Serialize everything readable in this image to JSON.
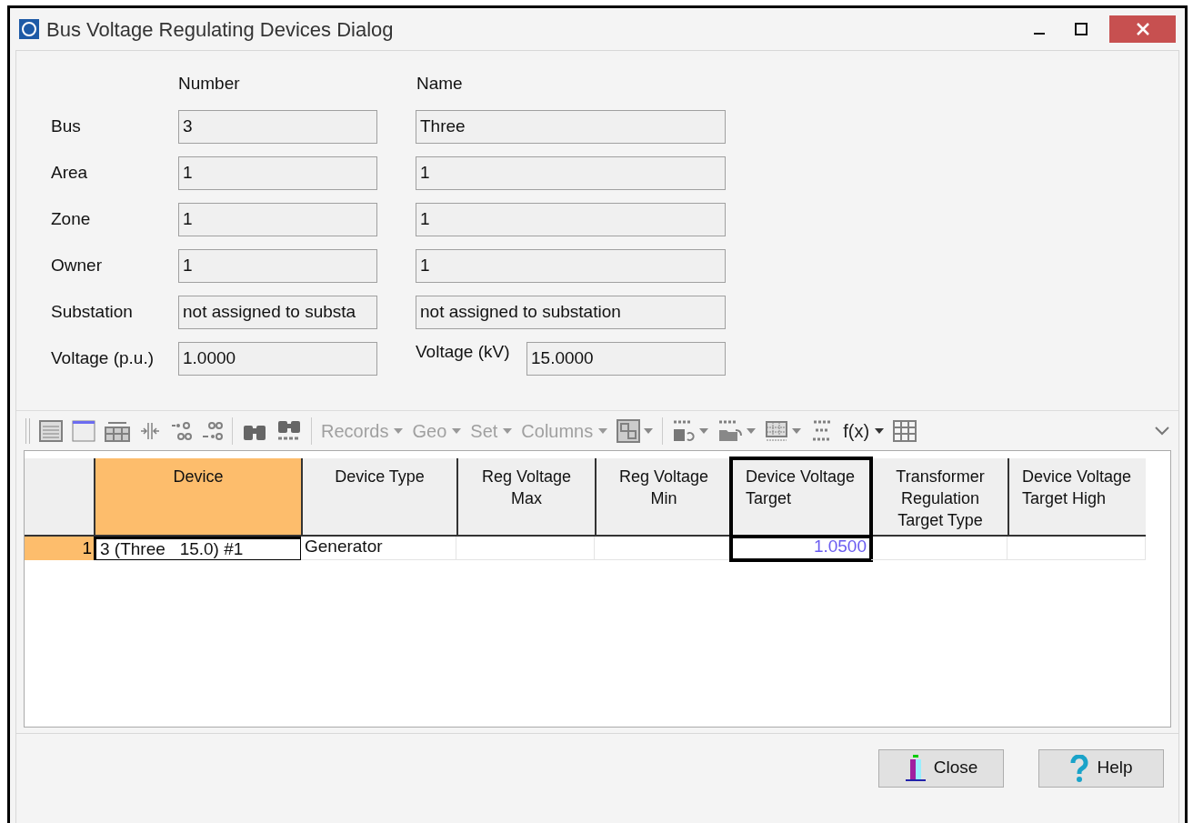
{
  "window": {
    "title": "Bus Voltage Regulating Devices Dialog"
  },
  "form": {
    "headers": [
      "Number",
      "Name"
    ],
    "rows": [
      {
        "label": "Bus",
        "number": "3",
        "name": "Three"
      },
      {
        "label": "Area",
        "number": "1",
        "name": "1"
      },
      {
        "label": "Zone",
        "number": "1",
        "name": "1"
      },
      {
        "label": "Owner",
        "number": "1",
        "name": "1"
      },
      {
        "label": "Substation",
        "number": "not assigned to substa",
        "name": "not assigned to substation"
      }
    ],
    "voltage": {
      "pu_label": "Voltage (p.u.)",
      "pu_value": "1.0000",
      "kv_label": "Voltage (kV)",
      "kv_value": "15.0000"
    }
  },
  "toolbar": {
    "items": [
      {
        "kind": "grip"
      },
      {
        "kind": "icon"
      },
      {
        "kind": "icon"
      },
      {
        "kind": "icon"
      },
      {
        "kind": "icon"
      },
      {
        "kind": "icon"
      },
      {
        "kind": "icon"
      },
      {
        "kind": "separator"
      },
      {
        "kind": "icon"
      },
      {
        "kind": "icon"
      },
      {
        "kind": "separator"
      },
      {
        "kind": "menu",
        "label": "Records",
        "disabled": true
      },
      {
        "kind": "menu",
        "label": "Geo",
        "disabled": true
      },
      {
        "kind": "menu",
        "label": "Set",
        "disabled": true
      },
      {
        "kind": "menu",
        "label": "Columns",
        "disabled": true
      },
      {
        "kind": "icon",
        "dropdown": true
      },
      {
        "kind": "separator"
      },
      {
        "kind": "icon",
        "dropdown": true
      },
      {
        "kind": "icon",
        "dropdown": true
      },
      {
        "kind": "icon",
        "dropdown": true
      },
      {
        "kind": "icon"
      },
      {
        "kind": "menu",
        "label": "f(x)",
        "disabled": false
      },
      {
        "kind": "icon"
      }
    ]
  },
  "table": {
    "columns": [
      {
        "label": "Device",
        "selected": true,
        "outlined": false
      },
      {
        "label": "Device Type",
        "selected": false,
        "outlined": false
      },
      {
        "label": "Reg Voltage Max",
        "selected": false,
        "outlined": false
      },
      {
        "label": "Reg Voltage Min",
        "selected": false,
        "outlined": false
      },
      {
        "label": "Device Voltage Target",
        "selected": false,
        "outlined": true
      },
      {
        "label": "Transformer Regulation Target Type",
        "selected": false,
        "outlined": false
      },
      {
        "label": "Device Voltage Target High",
        "selected": false,
        "outlined": false
      }
    ],
    "rows": [
      {
        "number": "1",
        "selected": true,
        "cells": [
          {
            "text": "3 (Three   15.0) #1",
            "focused": true,
            "editable": false
          },
          {
            "text": "Generator",
            "focused": false,
            "editable": false
          },
          {
            "text": "",
            "focused": false,
            "editable": false
          },
          {
            "text": "",
            "focused": false,
            "editable": false
          },
          {
            "text": "1.0500",
            "focused": false,
            "editable": true
          },
          {
            "text": "",
            "focused": false,
            "editable": false
          },
          {
            "text": "",
            "focused": false,
            "editable": false
          }
        ]
      }
    ]
  },
  "buttons": [
    {
      "kind": "close",
      "label": "Close"
    },
    {
      "kind": "help",
      "label": "Help"
    }
  ]
}
